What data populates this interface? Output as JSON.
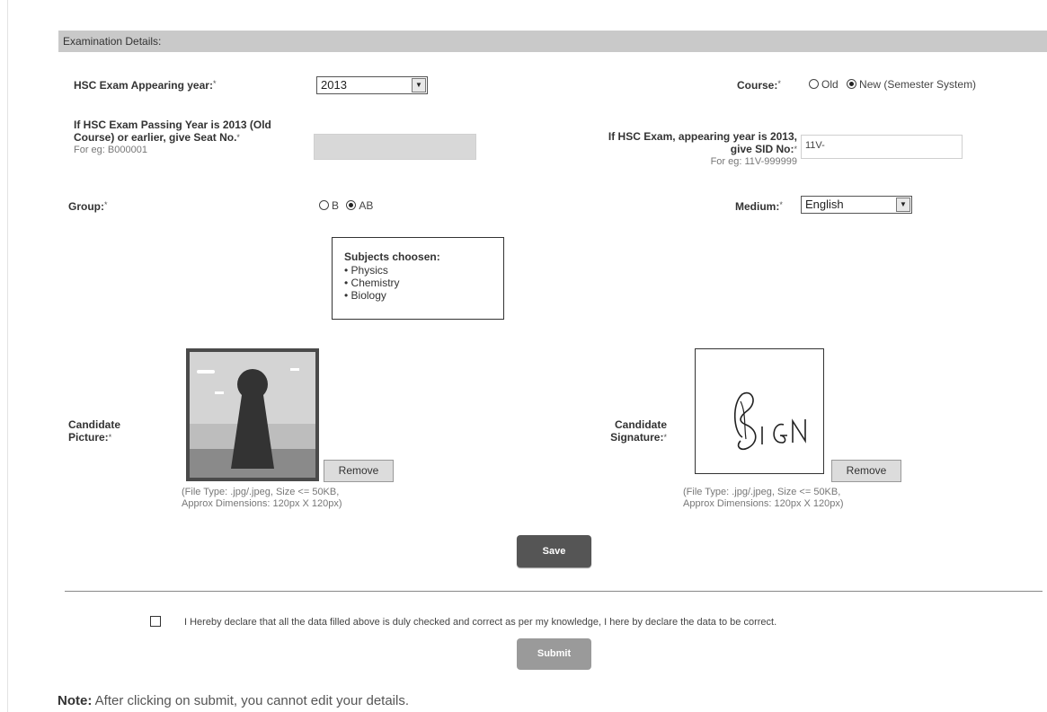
{
  "section": {
    "title": "Examination Details:"
  },
  "hsc_year": {
    "label": "HSC Exam Appearing year:",
    "req": "*",
    "value": "2013"
  },
  "course": {
    "label": "Course:",
    "req": "*",
    "opt_old": "Old",
    "opt_new": "New (Semester System)",
    "selected": "New (Semester System)"
  },
  "seat_no": {
    "label_line1": "If HSC Exam Passing Year is 2013 (Old",
    "label_line2": "Course) or earlier, give Seat No.",
    "req": "*",
    "hint": "For eg: B000001",
    "value": ""
  },
  "sid_no": {
    "label_line1": "If HSC Exam, appearing year is 2013,",
    "label_line2": "give SID No:",
    "req": "*",
    "hint": "For eg: 11V-999999",
    "value": "11V-"
  },
  "group": {
    "label": "Group:",
    "req": "*",
    "opt_b": "B",
    "opt_ab": "AB",
    "selected": "AB"
  },
  "medium": {
    "label": "Medium:",
    "req": "*",
    "value": "English"
  },
  "subjects": {
    "title": "Subjects choosen:",
    "items": [
      "Physics",
      "Chemistry",
      "Biology"
    ]
  },
  "picture": {
    "label_line1": "Candidate",
    "label_line2": "Picture:",
    "req": "*",
    "remove_label": "Remove",
    "hint_line1": "(File Type: .jpg/.jpeg, Size <= 50KB,",
    "hint_line2": "Approx Dimensions: 120px X 120px)"
  },
  "signature": {
    "label_line1": "Candidate",
    "label_line2": "Signature:",
    "req": "*",
    "remove_label": "Remove",
    "hint_line1": "(File Type: .jpg/.jpeg, Size <= 50KB,",
    "hint_line2": "Approx Dimensions: 120px X 120px)",
    "image_text": "SIGN"
  },
  "save_label": "Save",
  "declaration": {
    "text": "I Hereby declare that all the data filled above is duly checked and correct as per my knowledge, I here by declare the data to be correct.",
    "checked": false
  },
  "submit_label": "Submit",
  "note": {
    "prefix": "Note:",
    "text": " After clicking on submit, you cannot edit your details."
  },
  "colors": {
    "section_bar": "#c9c9c9",
    "save_button": "#555555",
    "submit_button": "#9a9a9a"
  }
}
